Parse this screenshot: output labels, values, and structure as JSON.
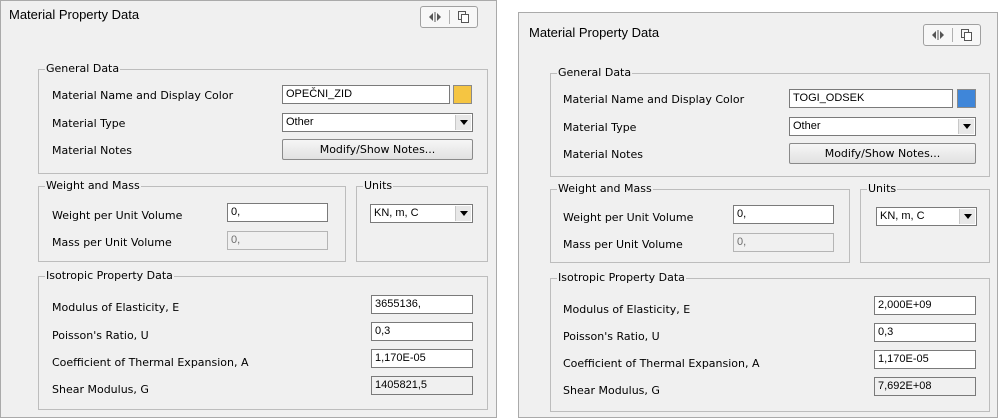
{
  "left": {
    "title": "Material Property Data",
    "general_group": "General Data",
    "name_label": "Material Name and Display Color",
    "name_value": "OPEČNI_ZID",
    "color": "#f5c542",
    "type_label": "Material Type",
    "type_value": "Other",
    "notes_label": "Material Notes",
    "notes_button": "Modify/Show Notes...",
    "weight_group": "Weight and Mass",
    "weight_label": "Weight per Unit Volume",
    "weight_value": "0,",
    "mass_label": "Mass per Unit Volume",
    "mass_value": "0,",
    "units_group": "Units",
    "units_value": "KN, m, C",
    "iso_group": "Isotropic Property Data",
    "modulus_label": "Modulus of Elasticity,  E",
    "modulus_value": "3655136,",
    "poisson_label": "Poisson's Ratio,  U",
    "poisson_value": "0,3",
    "thermal_label": "Coefficient of Thermal Expansion,  A",
    "thermal_value": "1,170E-05",
    "shear_label": "Shear Modulus,  G",
    "shear_value": "1405821,5"
  },
  "right": {
    "title": "Material Property Data",
    "general_group": "General Data",
    "name_label": "Material Name and Display Color",
    "name_value": "TOGI_ODSEK",
    "color": "#3f86d9",
    "type_label": "Material Type",
    "type_value": "Other",
    "notes_label": "Material Notes",
    "notes_button": "Modify/Show Notes...",
    "weight_group": "Weight and Mass",
    "weight_label": "Weight per Unit Volume",
    "weight_value": "0,",
    "mass_label": "Mass per Unit Volume",
    "mass_value": "0,",
    "units_group": "Units",
    "units_value": "KN, m, C",
    "iso_group": "Isotropic Property Data",
    "modulus_label": "Modulus of Elasticity,  E",
    "modulus_value": "2,000E+09",
    "poisson_label": "Poisson's Ratio,  U",
    "poisson_value": "0,3",
    "thermal_label": "Coefficient of Thermal Expansion,  A",
    "thermal_value": "1,170E-05",
    "shear_label": "Shear Modulus,  G",
    "shear_value": "7,692E+08"
  },
  "icons": {
    "split_view": "split-view-icon",
    "copy": "copy-icon",
    "dropdown": "chevron-down-icon"
  }
}
